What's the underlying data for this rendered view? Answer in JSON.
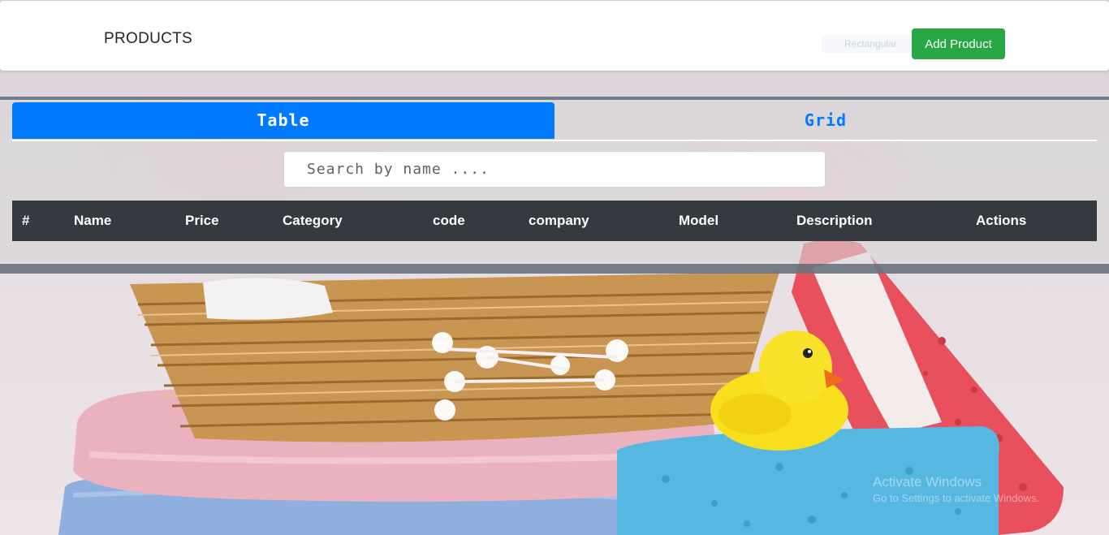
{
  "navbar": {
    "brand": "PRODUCTS",
    "ghost_text": "Rectangular Snip",
    "add_button": "Add Product"
  },
  "tabs": [
    {
      "label": "Table",
      "active": true
    },
    {
      "label": "Grid",
      "active": false
    }
  ],
  "search": {
    "placeholder": "Search by name ...."
  },
  "table": {
    "columns": [
      "#",
      "Name",
      "Price",
      "Category",
      "code",
      "company",
      "Model",
      "Description",
      "Actions"
    ],
    "rows": []
  },
  "watermark": {
    "line1": "Activate Windows",
    "line2": "Go to Settings to activate Windows."
  },
  "colors": {
    "primary": "#007bff",
    "success": "#28a745",
    "table_head": "#343a40"
  }
}
